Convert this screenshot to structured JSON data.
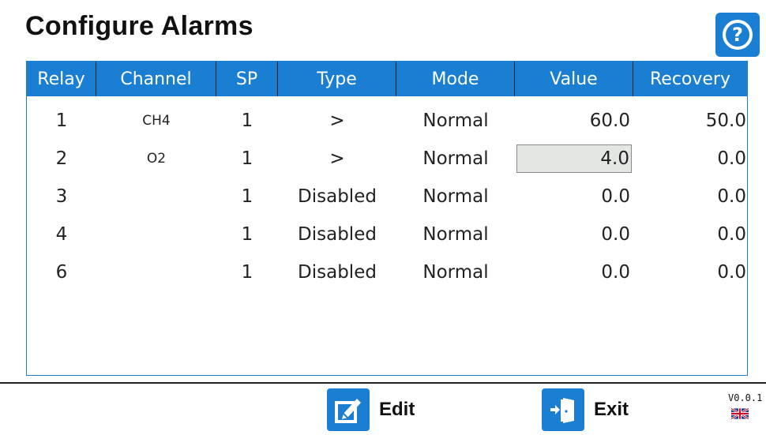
{
  "title": "Configure Alarms",
  "help_icon": "question-circle-icon",
  "columns": [
    "Relay",
    "Channel",
    "SP",
    "Type",
    "Mode",
    "Value",
    "Recovery"
  ],
  "rows": [
    {
      "relay": "1",
      "channel": "CH4",
      "sp": "1",
      "type": ">",
      "mode": "Normal",
      "value": "60.0",
      "recovery": "50.0"
    },
    {
      "relay": "2",
      "channel": "O2",
      "sp": "1",
      "type": ">",
      "mode": "Normal",
      "value": "4.0",
      "recovery": "0.0"
    },
    {
      "relay": "3",
      "channel": "",
      "sp": "1",
      "type": "Disabled",
      "mode": "Normal",
      "value": "0.0",
      "recovery": "0.0"
    },
    {
      "relay": "4",
      "channel": "",
      "sp": "1",
      "type": "Disabled",
      "mode": "Normal",
      "value": "0.0",
      "recovery": "0.0"
    },
    {
      "relay": "6",
      "channel": "",
      "sp": "1",
      "type": "Disabled",
      "mode": "Normal",
      "value": "0.0",
      "recovery": "0.0"
    }
  ],
  "selected_cell": {
    "row": 2,
    "column": "Value"
  },
  "footer": {
    "edit_label": "Edit",
    "exit_label": "Exit",
    "edit_icon": "edit-icon",
    "exit_icon": "exit-door-icon",
    "version": "V0.0.1",
    "language_icon": "uk-flag-icon"
  },
  "colors": {
    "accent": "#1a7fd3",
    "selected_cell_bg": "#e4e6e4"
  }
}
